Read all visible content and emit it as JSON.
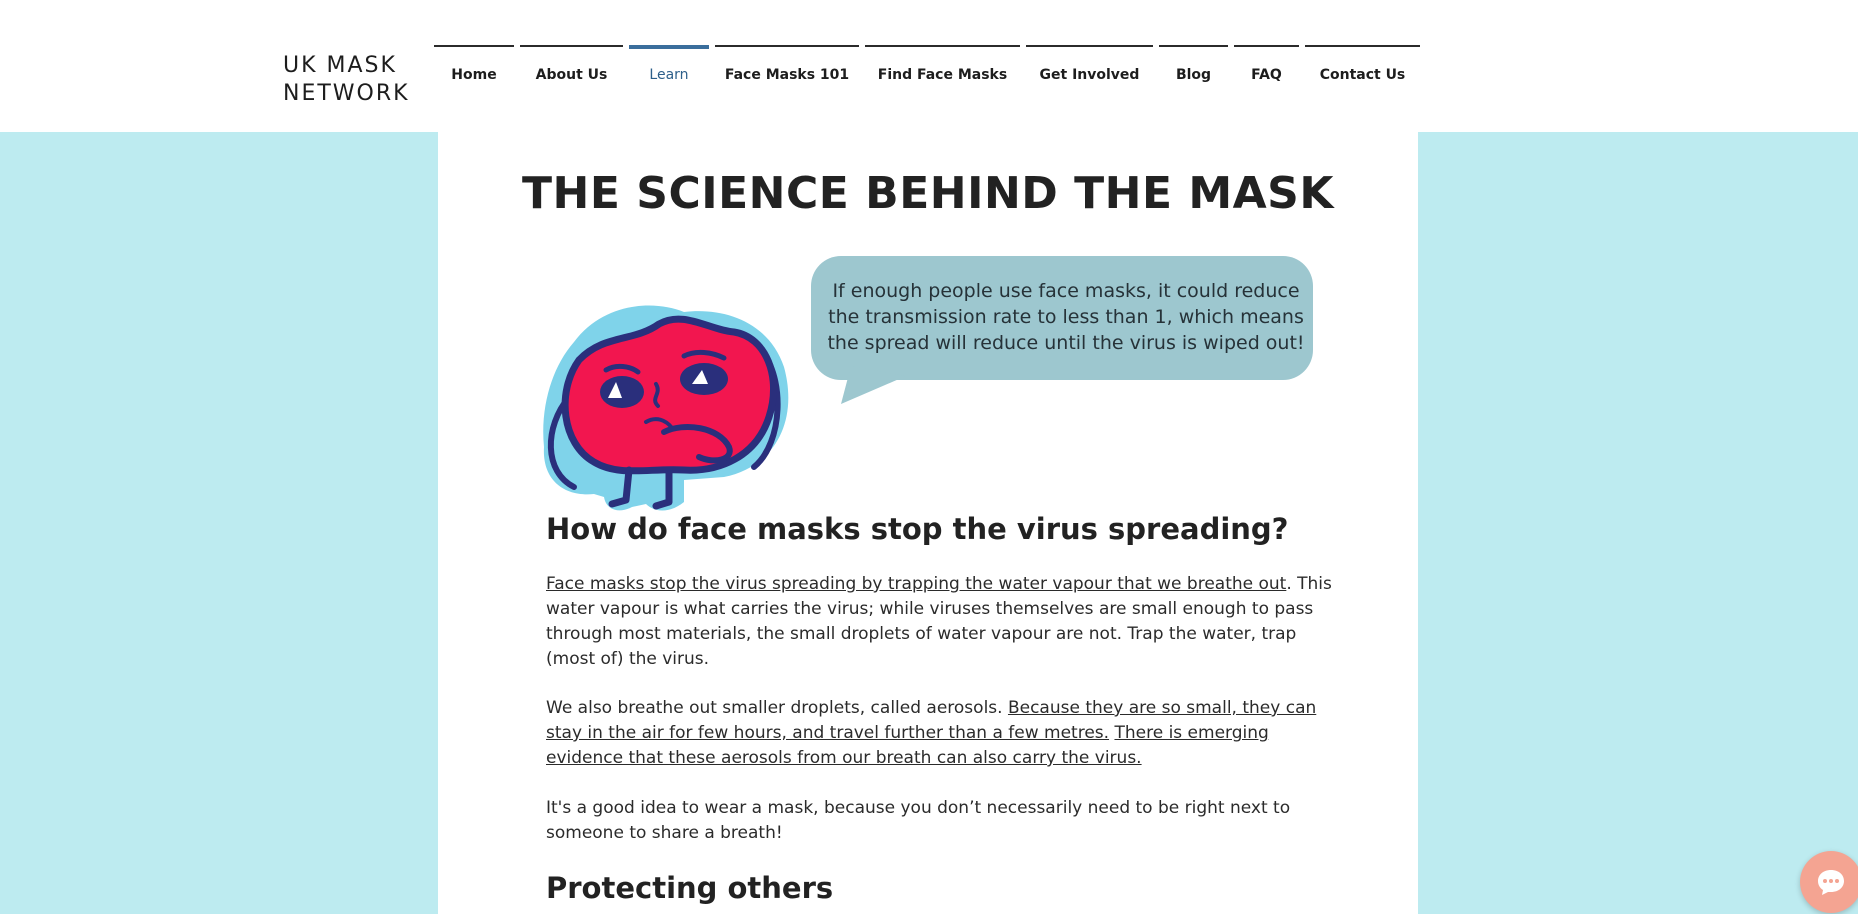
{
  "header": {
    "logo_line1": "UK MASK",
    "logo_line2": "NETWORK"
  },
  "nav": {
    "items": [
      {
        "label": "Home"
      },
      {
        "label": "About Us"
      },
      {
        "label": "Learn",
        "active": true
      },
      {
        "label": "Face Masks 101"
      },
      {
        "label": "Find Face Masks"
      },
      {
        "label": "Get Involved"
      },
      {
        "label": "Blog"
      },
      {
        "label": "FAQ"
      },
      {
        "label": "Contact Us"
      }
    ]
  },
  "page": {
    "title": "THE SCIENCE BEHIND THE MASK",
    "bubble_text": "If enough people use face masks, it could reduce the transmission rate to less than 1, which means the spread will reduce until the virus is wiped out!",
    "section1_heading": "How do face masks stop the virus spreading?",
    "p1_link": "Face masks stop the virus spreading by trapping the water vapour that we breathe out",
    "p1_rest": ". This water vapour is what carries the virus; while viruses themselves are small enough to pass through most materials, the small droplets of water vapour are not. Trap the water, trap (most of) the virus.",
    "p2_text": "We also breathe out smaller droplets, called aerosols. ",
    "p2_link1": "Because they are so small, they can stay in the air for few hours, and travel further than a few metres.",
    "p2_space": " ",
    "p2_link2": "There is emerging evidence that these aerosols from our breath can also carry the virus.",
    "p3_text": "It's a good idea to wear a mask, because you don’t necessarily need to be right next to someone to share a breath!",
    "section2_heading": "Protecting others"
  },
  "colors": {
    "page_background": "#bdebf0",
    "bubble": "#9dc7cf",
    "nav_active": "#3a6e9c",
    "mascot_body": "#f2164f",
    "mascot_outline": "#2a2f7c",
    "chat_button": "#f4a492"
  },
  "icons": {
    "mascot": "mask-character-illustration",
    "chat": "chat-bubble-icon"
  }
}
